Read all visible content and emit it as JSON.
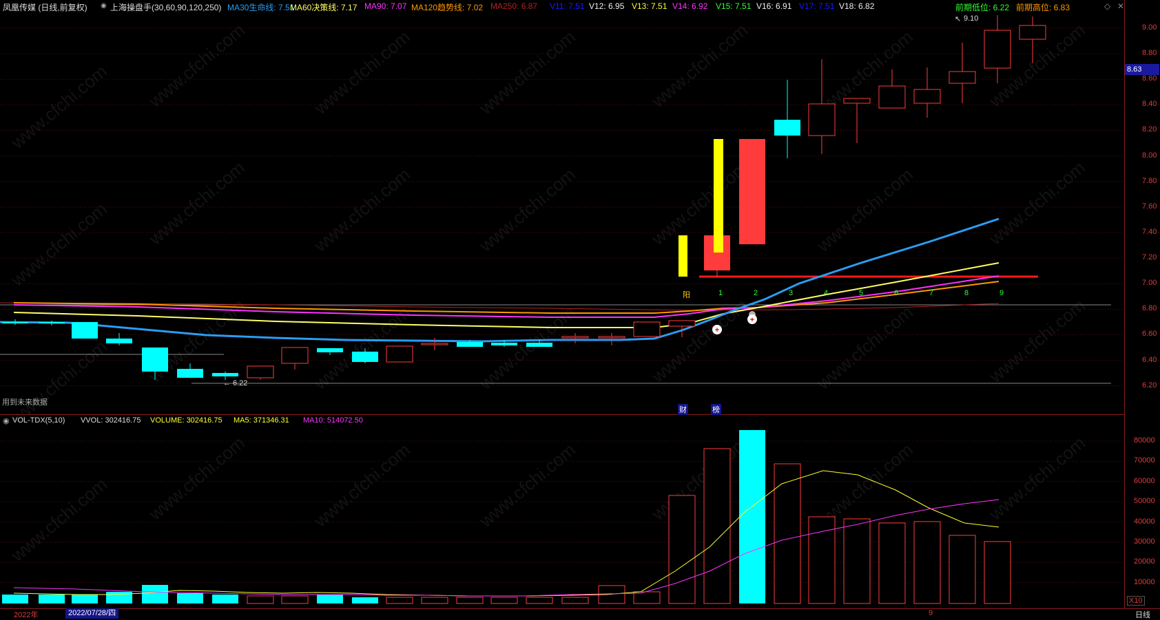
{
  "header": {
    "stock": "凤凰传媒 (日线,前复权)",
    "indicator_name": "上海操盘手(30,60,90,120,250)",
    "ma30": "MA30生命线: 7.51",
    "ma60": "MA60决策线: 7.17",
    "ma90": "MA90: 7.07",
    "ma120": "MA120趋势线: 7.02",
    "ma250": "MA250: 6.87",
    "v11": "V11: 7.51",
    "v12": "V12: 6.95",
    "v13": "V13: 7.51",
    "v14": "V14: 6.92",
    "v15": "V15: 7.51",
    "v16": "V16: 6.91",
    "v17": "V17: 7.51",
    "v18": "V18: 6.82",
    "prev_low": "前期低位: 6.22",
    "prev_high": "前期高位: 6.83"
  },
  "price_axis": [
    "9.00",
    "8.80",
    "8.60",
    "8.40",
    "8.20",
    "8.00",
    "7.80",
    "7.60",
    "7.40",
    "7.20",
    "7.00",
    "6.80",
    "6.60",
    "6.40",
    "6.20"
  ],
  "current_price": "8.63",
  "annotations": {
    "high_label": "9.10",
    "low_label": "6.22",
    "future_data": "用到未来数据",
    "yang": "阳",
    "counts": [
      "1",
      "2",
      "3",
      "4",
      "5",
      "6",
      "7",
      "8",
      "9"
    ],
    "cai": "财",
    "bang": "榜"
  },
  "volume_header": {
    "name": "VOL-TDX(5,10)",
    "vvol": "VVOL: 302416.75",
    "volume": "VOLUME: 302416.75",
    "ma5": "MA5: 371346.31",
    "ma10": "MA10: 514072.50"
  },
  "volume_axis": [
    "80000",
    "70000",
    "60000",
    "50000",
    "40000",
    "30000",
    "20000",
    "10000"
  ],
  "volume_unit": "X10",
  "bottom": {
    "year": "2022年",
    "date": "2022/07/28/四",
    "month": "9",
    "period": "日线"
  },
  "watermark": "www.cfchi.com",
  "colors": {
    "up": "#ff3b3b",
    "down": "#00ffff",
    "ma30": "#2a9df4",
    "ma60": "#ffff66",
    "ma90": "#ff33ff",
    "ma120": "#ff9900",
    "ma250": "#b22222"
  }
}
